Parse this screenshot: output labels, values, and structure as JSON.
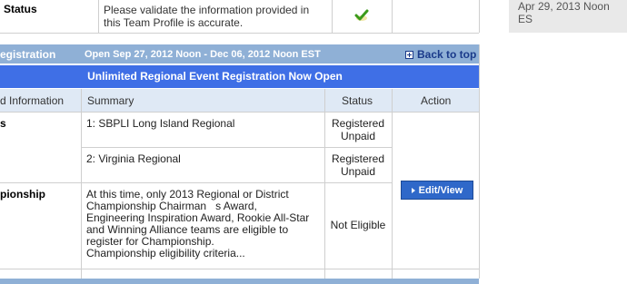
{
  "status_row": {
    "label": "Status",
    "message_line1": "Please validate the information provided in",
    "message_line2": "this Team Profile is accurate.",
    "check_icon": "checkmark-icon"
  },
  "side_panel": {
    "timestamp": "Apr 29, 2013 Noon ES"
  },
  "section": {
    "title": "egistration",
    "dates": "Open Sep 27, 2012 Noon - Dec 06, 2012 Noon EST",
    "back_to_top": "Back to top",
    "icon": "plus-box-icon"
  },
  "banner": {
    "text": "Unlimited Regional Event Registration Now Open"
  },
  "table": {
    "headers": {
      "info": "d Information",
      "summary": "Summary",
      "status": "Status",
      "action": "Action"
    },
    "rows": [
      {
        "info": "s",
        "summary": "1: SBPLI Long Island Regional",
        "status_line1": "Registered",
        "status_line2": "Unpaid"
      },
      {
        "info": "",
        "summary": "2: Virginia Regional",
        "status_line1": "Registered",
        "status_line2": "Unpaid"
      },
      {
        "info": "pionship",
        "summary_lines": [
          "At this time, only 2013 Regional or District",
          "Championship Chairman   s Award,",
          "Engineering Inspiration Award, Rookie All-Star",
          "and Winning Alliance teams are eligible to",
          "register for Championship.",
          "Championship eligibility criteria..."
        ],
        "status": "Not Eligible"
      }
    ],
    "action_button": "Edit/View"
  },
  "colors": {
    "section_bar": "#8fb0d6",
    "banner": "#3f6fe6",
    "header_row": "#dfe9f5",
    "button": "#2f68c9"
  }
}
